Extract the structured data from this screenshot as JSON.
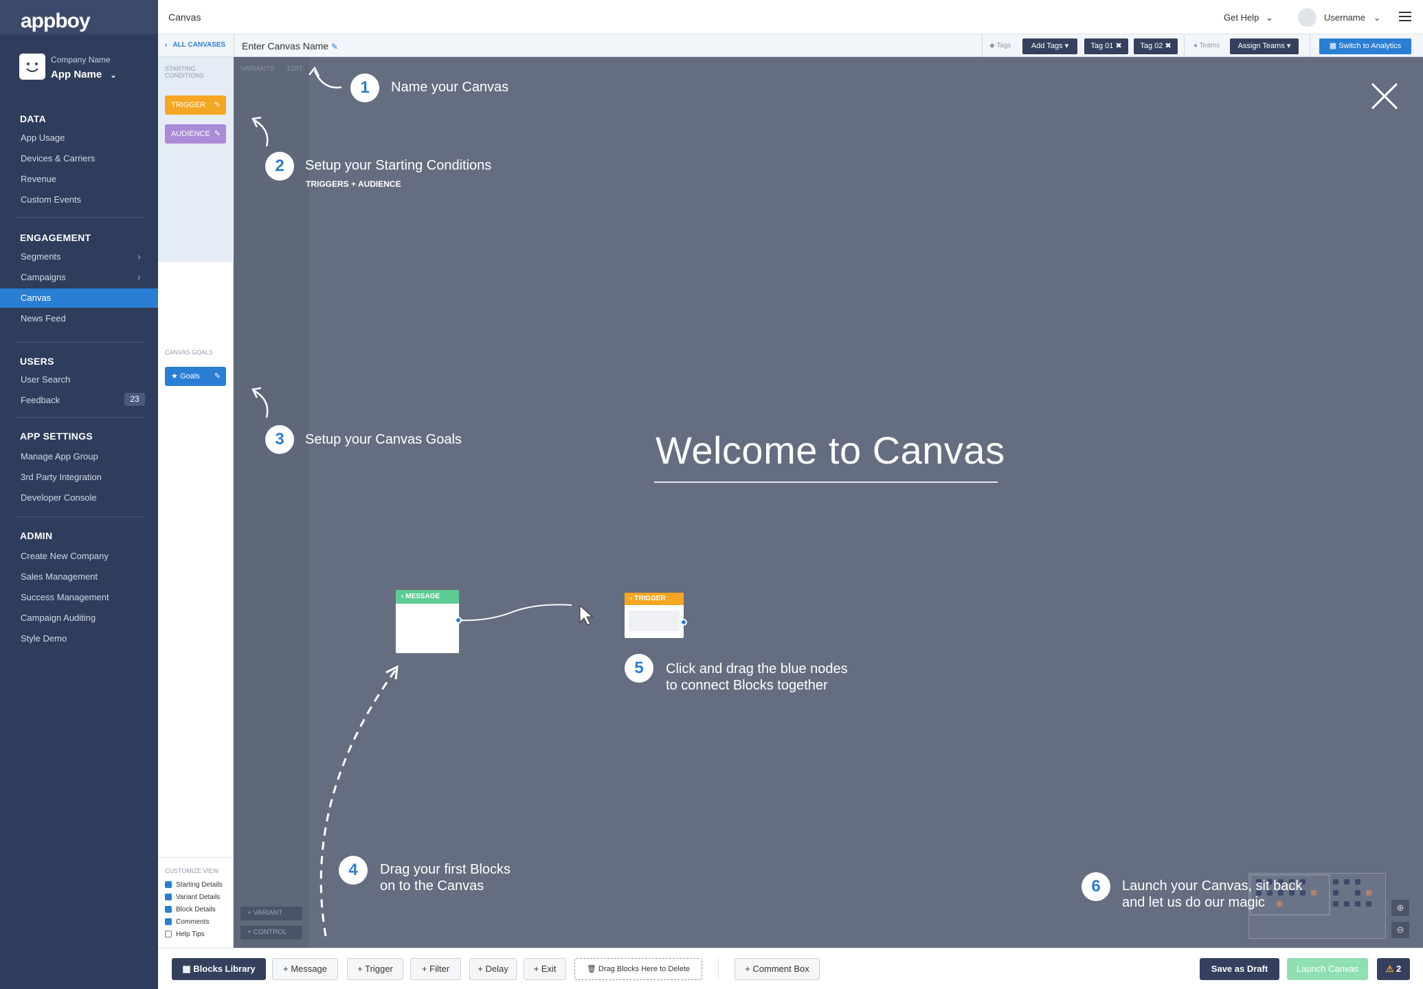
{
  "sidebar": {
    "logo": "appboy",
    "company_label": "Company Name",
    "app_name": "App Name",
    "sections": {
      "data": {
        "title": "DATA",
        "items": [
          "App Usage",
          "Devices & Carriers",
          "Revenue",
          "Custom Events"
        ]
      },
      "engagement": {
        "title": "ENGAGEMENT",
        "items": [
          "Segments",
          "Campaigns",
          "Canvas",
          "News Feed"
        ]
      },
      "users": {
        "title": "USERS",
        "items": [
          "User Search",
          "Feedback"
        ],
        "feedback_count": "23"
      },
      "app_settings": {
        "title": "APP SETTINGS",
        "items": [
          "Manage App Group",
          "3rd Party Integration",
          "Developer Console"
        ]
      },
      "admin": {
        "title": "ADMIN",
        "items": [
          "Create New Company",
          "Sales Management",
          "Success Management",
          "Campaign Auditing",
          "Style Demo"
        ]
      }
    },
    "active_item": "Canvas"
  },
  "topbar": {
    "title": "Canvas",
    "help": "Get Help",
    "username": "Username"
  },
  "subbar": {
    "back": "ALL CANVASES",
    "canvas_name_placeholder": "Enter Canvas Name",
    "tags_label": "Tags",
    "add_tags": "Add Tags",
    "tags": [
      "Tag 01",
      "Tag 02"
    ],
    "teams_label": "Teams",
    "assign_teams": "Assign Teams",
    "switch_analytics": "Switch to Analytics"
  },
  "left_panel": {
    "starting_conditions": "STARTING CONDITIONS",
    "trigger": "TRIGGER",
    "audience": "AUDIENCE",
    "tabs": [
      "VARIANTS",
      "EDIT"
    ],
    "canvas_goals": "CANVAS GOALS",
    "goals": "Goals",
    "customize_view": "CUSTOMIZE VIEW",
    "view_options": [
      {
        "label": "Starting Details",
        "checked": true
      },
      {
        "label": "Variant Details",
        "checked": true
      },
      {
        "label": "Block Details",
        "checked": true
      },
      {
        "label": "Comments",
        "checked": true
      },
      {
        "label": "Help Tips",
        "checked": false
      }
    ],
    "add_variant": "+ VARIANT",
    "add_control": "+ CONTROL"
  },
  "tour": {
    "welcome": "Welcome to Canvas",
    "steps": [
      {
        "num": "1",
        "text": "Name your Canvas"
      },
      {
        "num": "2",
        "text": "Setup your Starting Conditions",
        "sub": "TRIGGERS + AUDIENCE"
      },
      {
        "num": "3",
        "text": "Setup your Canvas Goals"
      },
      {
        "num": "4",
        "line1": "Drag your first Blocks",
        "line2": "on to the Canvas"
      },
      {
        "num": "5",
        "line1": "Click and drag the blue nodes",
        "line2": "to connect Blocks together"
      },
      {
        "num": "6",
        "line1": "Launch your Canvas, sit back",
        "line2": "and let us do our magic"
      }
    ],
    "demo_message": "MESSAGE",
    "demo_trigger": "TRIGGER"
  },
  "bottombar": {
    "blocks_library": "Blocks Library",
    "message": "+ Message",
    "trigger": "+ Trigger",
    "filter": "+ Filter",
    "delay": "+ Delay",
    "exit": "+ Exit",
    "delete_zone": "Drag Blocks Here to Delete",
    "comment_box": "+ Comment Box",
    "save_draft": "Save as Draft",
    "launch": "Launch Canvas",
    "warnings": "2"
  },
  "colors": {
    "sidebar": "#2f3d5c",
    "accent": "#2a7ed3",
    "canvas_bg": "#656e80",
    "trigger": "#f5a623",
    "audience": "#a98bd6",
    "message": "#5dcb94",
    "launch": "#8fdfb2"
  }
}
